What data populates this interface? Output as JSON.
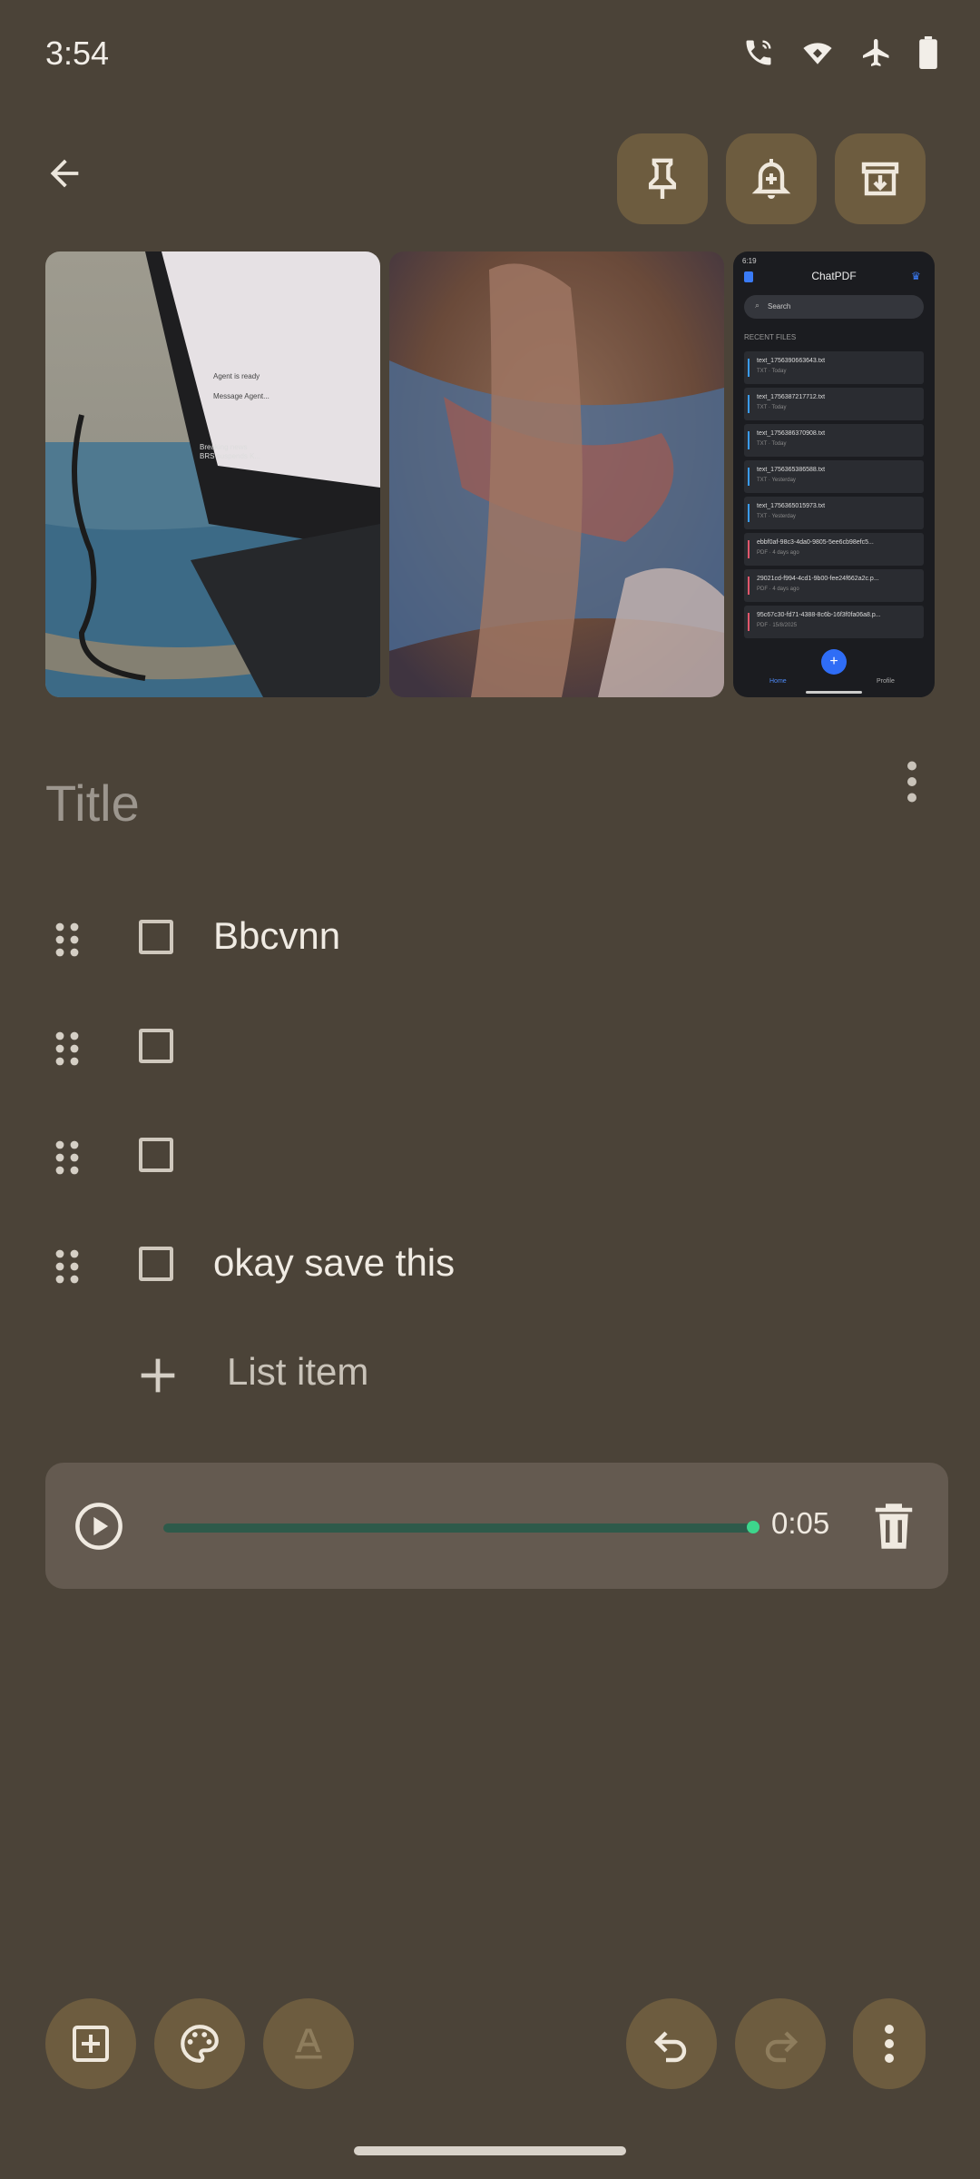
{
  "status_bar": {
    "time": "3:54",
    "icons": [
      "wifi-calling-icon",
      "wifi-icon",
      "airplane-icon",
      "battery-icon"
    ]
  },
  "toolbar": {
    "back": "arrow-back-icon",
    "pin": "pin-icon",
    "reminder": "bell-plus-icon",
    "archive": "archive-icon"
  },
  "attachments": [
    {
      "name": "photo-laptop",
      "overlay_lines": [
        "Agent is ready",
        "Message Agent...",
        "Breaking news",
        "BRS suspends K..."
      ]
    },
    {
      "name": "photo-blurred-hand"
    },
    {
      "name": "screenshot-chatpdf",
      "app_title": "ChatPDF",
      "time": "6:19",
      "search_placeholder": "Search",
      "section": "RECENT FILES",
      "files": [
        {
          "name": "text_1756390663643.txt",
          "meta": "TXT · Today"
        },
        {
          "name": "text_1756387217712.txt",
          "meta": "TXT · Today"
        },
        {
          "name": "text_1756386370908.txt",
          "meta": "TXT · Today"
        },
        {
          "name": "text_1756365386588.txt",
          "meta": "TXT · Yesterday"
        },
        {
          "name": "text_1756365015973.txt",
          "meta": "TXT · Yesterday"
        },
        {
          "name": "ebbf0af-98c3-4da0-9805-5ee6cb98efc5...",
          "meta": "PDF · 4 days ago"
        },
        {
          "name": "29021cd-f994-4cd1-9b00-fee24f662a2c.p...",
          "meta": "PDF · 4 days ago"
        },
        {
          "name": "95c67c30-fd71-4388-8c6b-16f3f0fa06a8.p...",
          "meta": "PDF · 15/8/2025"
        }
      ],
      "nav": [
        "Home",
        "Profile"
      ]
    }
  ],
  "note": {
    "title_placeholder": "Title",
    "checklist": [
      {
        "text": "Bbcvnn",
        "checked": false
      },
      {
        "text": "",
        "checked": false
      },
      {
        "text": "",
        "checked": false
      },
      {
        "text": "okay save this",
        "checked": false
      }
    ],
    "add_item_label": "List item"
  },
  "audio": {
    "duration": "0:05",
    "progress": 1.0,
    "track_color": "#2e5a4a",
    "thumb_color": "#3dd68c"
  },
  "bottom_bar": {
    "buttons": [
      "add-box-icon",
      "palette-icon",
      "text-format-icon",
      "undo-icon",
      "redo-icon",
      "more-vert-icon"
    ]
  },
  "colors": {
    "background": "#4b4338",
    "button_bg": "#6d5c3f",
    "card_bg": "#645a50"
  }
}
